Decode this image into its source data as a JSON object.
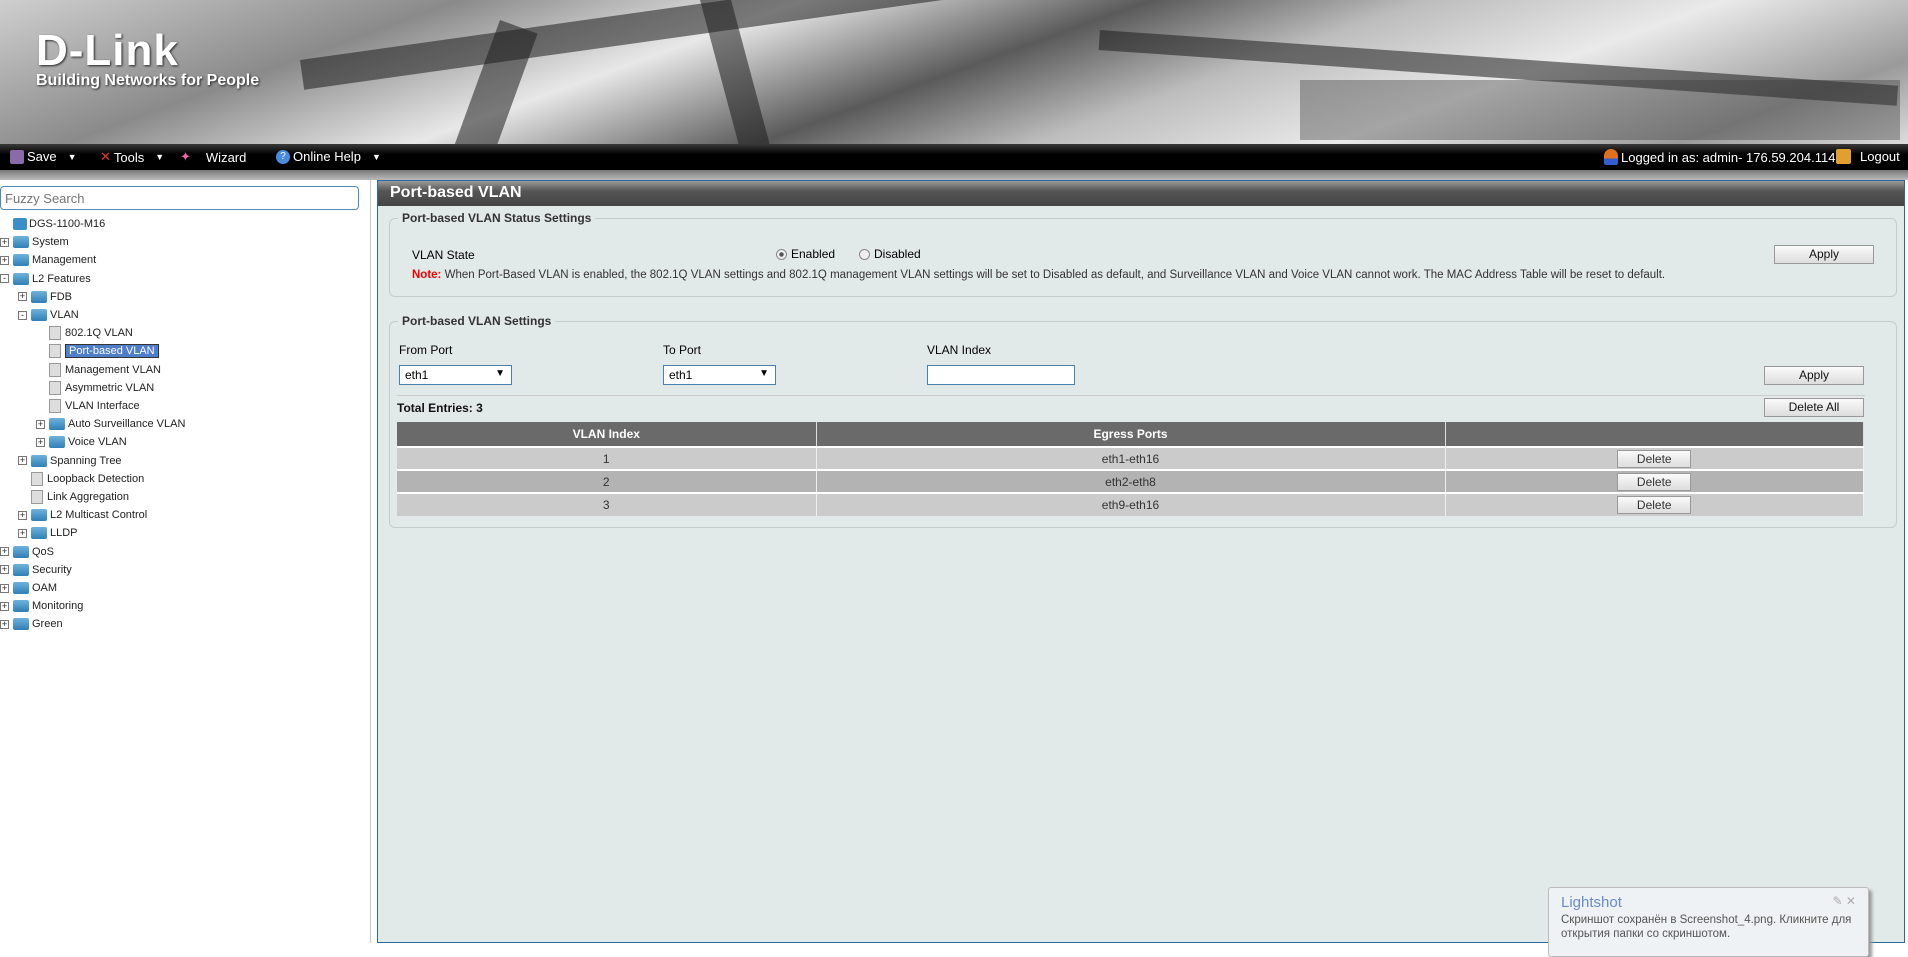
{
  "brand": {
    "logo": "D-Link",
    "tagline": "Building Networks for People"
  },
  "toolbar": {
    "save": "Save",
    "tools": "Tools",
    "wizard": "Wizard",
    "help": "Online Help",
    "logged_in": "Logged in as: admin- 176.59.204.114",
    "logout": "Logout"
  },
  "sidebar": {
    "search_placeholder": "Fuzzy Search",
    "tree": [
      {
        "label": "DGS-1100-M16"
      },
      {
        "label": "System"
      },
      {
        "label": "Management"
      },
      {
        "label": "L2 Features"
      },
      {
        "label": "FDB"
      },
      {
        "label": "VLAN"
      },
      {
        "label": "802.1Q VLAN"
      },
      {
        "label": "Port-based VLAN"
      },
      {
        "label": "Management VLAN"
      },
      {
        "label": "Asymmetric VLAN"
      },
      {
        "label": "VLAN Interface"
      },
      {
        "label": "Auto Surveillance VLAN"
      },
      {
        "label": "Voice VLAN"
      },
      {
        "label": "Spanning Tree"
      },
      {
        "label": "Loopback Detection"
      },
      {
        "label": "Link Aggregation"
      },
      {
        "label": "L2 Multicast Control"
      },
      {
        "label": "LLDP"
      },
      {
        "label": "QoS"
      },
      {
        "label": "Security"
      },
      {
        "label": "OAM"
      },
      {
        "label": "Monitoring"
      },
      {
        "label": "Green"
      }
    ]
  },
  "page": {
    "title": "Port-based VLAN",
    "status": {
      "legend": "Port-based VLAN Status Settings",
      "state_label": "VLAN State",
      "enabled": "Enabled",
      "disabled": "Disabled",
      "selected": "Enabled",
      "apply": "Apply",
      "note_label": "Note:",
      "note": " When Port-Based VLAN is enabled, the 802.1Q VLAN settings and 802.1Q management VLAN settings will be set to Disabled as default, and Surveillance VLAN and Voice VLAN cannot work. The MAC Address Table will be reset to default."
    },
    "settings": {
      "legend": "Port-based VLAN Settings",
      "from_label": "From Port",
      "from_value": "eth1",
      "to_label": "To Port",
      "to_value": "eth1",
      "index_label": "VLAN Index",
      "index_value": "",
      "apply": "Apply",
      "total": "Total Entries: 3",
      "delete_all": "Delete All",
      "columns": [
        "VLAN Index",
        "Egress Ports",
        ""
      ],
      "rows": [
        {
          "index": "1",
          "ports": "eth1-eth16",
          "action": "Delete"
        },
        {
          "index": "2",
          "ports": "eth2-eth8",
          "action": "Delete"
        },
        {
          "index": "3",
          "ports": "eth9-eth16",
          "action": "Delete"
        }
      ]
    }
  },
  "lightshot": {
    "title": "Lightshot",
    "message": "Скриншот сохранён в Screenshot_4.png. Кликните для открытия папки со скриншотом."
  }
}
